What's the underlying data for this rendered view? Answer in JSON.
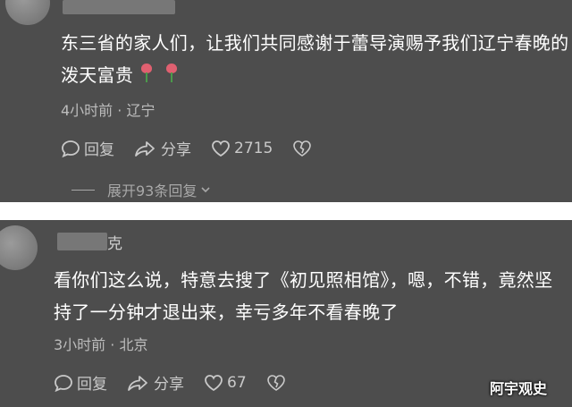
{
  "comments": [
    {
      "name_visible": "",
      "text": "东三省的家人们，让我们共同感谢于蕾导演赐予我们辽宁春晚的泼天富贵",
      "emoji": [
        "rose-icon",
        "rose-icon"
      ],
      "meta": "4小时前 · 辽宁",
      "reply_label": "回复",
      "share_label": "分享",
      "like_count": "2715",
      "expand_label": "展开93条回复"
    },
    {
      "name_visible": "克",
      "text": "看你们这么说，特意去搜了《初见照相馆》，嗯，不错，竟然坚持了一分钟才退出来，幸亏多年不看春晚了",
      "meta": "3小时前 · 北京",
      "reply_label": "回复",
      "share_label": "分享",
      "like_count": "67"
    }
  ],
  "watermark": "阿宇观史",
  "colors": {
    "panel_bg": "#4d4d4d",
    "text": "#ffffff",
    "meta": "#bcbcbc"
  }
}
